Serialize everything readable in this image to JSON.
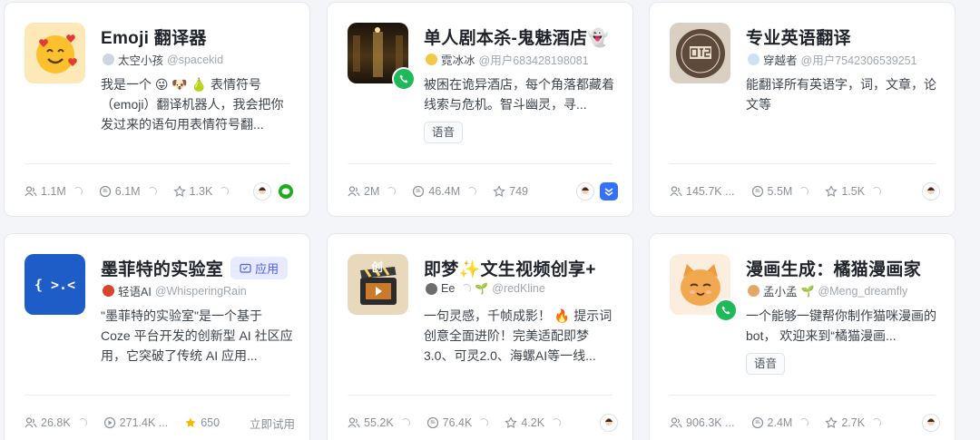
{
  "cards": [
    {
      "title": "Emoji 翻译器",
      "author": "太空小孩",
      "handle": "@spacekid",
      "description": "我是一个 😜 🐶 🍐 表情符号（emoji）翻译机器人，我会把你发过来的语句用表情符号翻...",
      "stats": {
        "users": "1.1M",
        "messages": "6.1M",
        "favorites": "1.3K"
      },
      "platform_icon": "wechat-icon",
      "accent": "#f7c948"
    },
    {
      "title": "单人剧本杀-鬼魅酒店👻",
      "author": "霓冰冰",
      "handle": "@用户683428198081",
      "description": "被困在诡异酒店，每个角落都藏着线索与危机。智斗幽灵，寻...",
      "tag": "语音",
      "stats": {
        "users": "2M",
        "messages": "46.4M",
        "favorites": "749"
      },
      "platform_icon": "feishu-icon",
      "accent": "#2a1d10"
    },
    {
      "title": "专业英语翻译",
      "author": "穿越者",
      "handle": "@用户7542306539251",
      "description": "能翻译所有英语字，词，文章，论文等",
      "stats": {
        "users": "145.7K ...",
        "messages": "5.5M",
        "favorites": "1.5K"
      },
      "accent": "#6b5a48"
    },
    {
      "title": "墨菲特的实验室",
      "app_label": "应用",
      "author": "轻语AI",
      "handle": "@WhisperingRain",
      "description": "\"墨菲特的实验室\"是一个基于 Coze 平台开发的创新型 AI 社区应用，它突破了传统 AI 应用...",
      "stats": {
        "users": "26.8K",
        "runs": "271.4K ...",
        "favorites": "650"
      },
      "try_label": "立即试用",
      "logo_text": "{ >.<",
      "accent": "#1e5cc8"
    },
    {
      "title": "即梦✨文生视频创享+",
      "author": "Ee",
      "handle": "@redKline",
      "description": "一句灵感，千帧成影！ 🔥 提示词创意全面进阶！完美适配即梦3.0、可灵2.0、海螺AI等一线...",
      "stats": {
        "users": "55.2K",
        "messages": "76.4K",
        "favorites": "4.2K"
      },
      "logo_text": "创",
      "accent": "#3b2a1a"
    },
    {
      "title": "漫画生成：橘猫漫画家",
      "author": "孟小孟",
      "handle": "@Meng_dreamfly",
      "description": "一个能够一键帮你制作猫咪漫画的bot， 欢迎来到“橘猫漫画...",
      "tag": "语音",
      "stats": {
        "users": "906.3K ...",
        "messages": "2.4M",
        "favorites": "2.7K"
      },
      "accent": "#f0a24a"
    }
  ]
}
